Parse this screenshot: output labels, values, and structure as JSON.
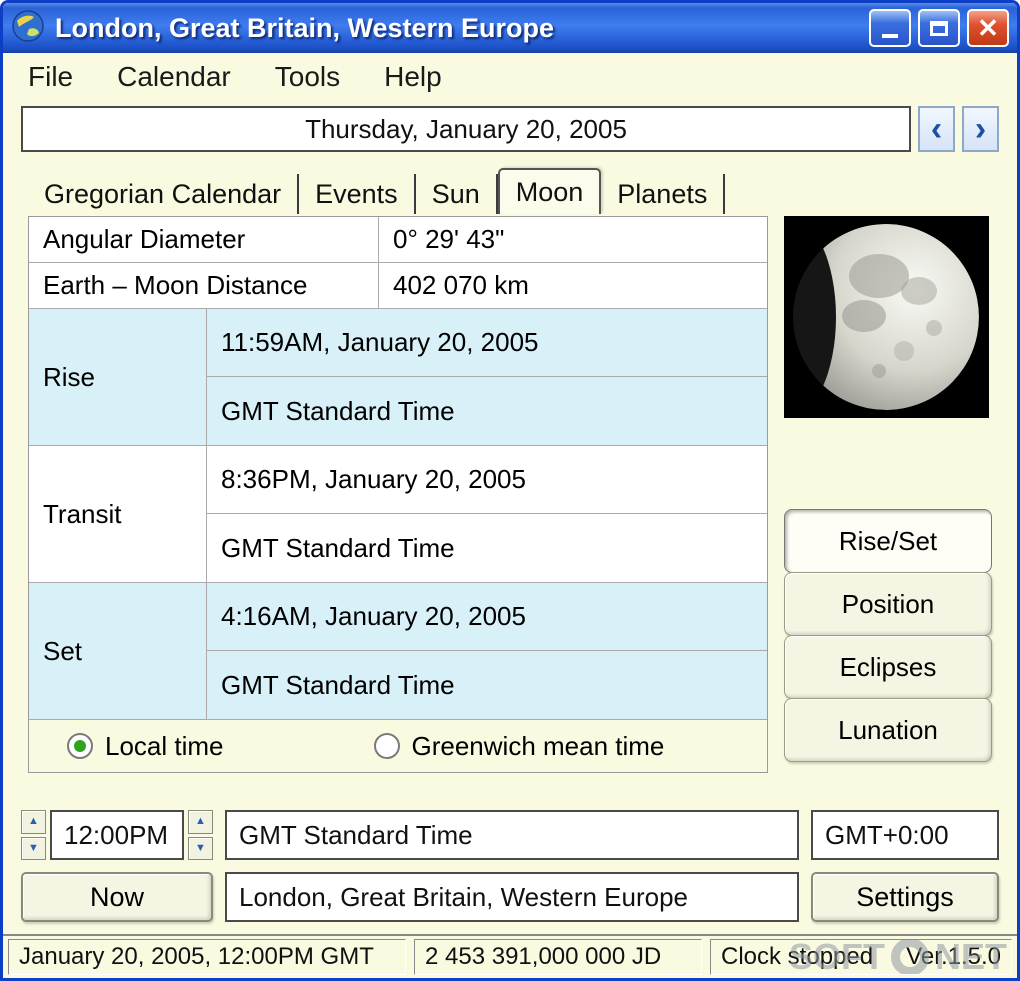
{
  "window": {
    "title": "London, Great Britain, Western Europe"
  },
  "icons": {
    "close": "✕",
    "spin_up": "▲",
    "spin_down": "▼"
  },
  "colors": {
    "titlebar_blue": "#2A62D8",
    "row_highlight_cyan": "#D8F0F8",
    "background_cream": "#FAFAE1",
    "radio_selected_green": "#2EA41C",
    "close_button_red": "#E0512E"
  },
  "menu": {
    "items": [
      "File",
      "Calendar",
      "Tools",
      "Help"
    ]
  },
  "date_nav": {
    "value": "Thursday, January 20, 2005",
    "prev": "‹",
    "next": "›"
  },
  "tabs": {
    "items": [
      "Gregorian Calendar",
      "Events",
      "Sun",
      "Moon",
      "Planets"
    ],
    "active": "Moon"
  },
  "moon_panel": {
    "info_rows": [
      {
        "label": "Angular Diameter",
        "value": "0° 29' 43\""
      },
      {
        "label": "Earth – Moon Distance",
        "value": "402 070 km"
      }
    ],
    "event_rows": [
      {
        "label": "Rise",
        "time": "11:59AM, January 20, 2005",
        "zone": "GMT Standard Time"
      },
      {
        "label": "Transit",
        "time": "8:36PM, January 20, 2005",
        "zone": "GMT Standard Time"
      },
      {
        "label": "Set",
        "time": "4:16AM, January 20, 2005",
        "zone": "GMT Standard Time"
      }
    ],
    "radios": [
      {
        "label": "Local time",
        "selected": true
      },
      {
        "label": "Greenwich mean time",
        "selected": false
      }
    ],
    "side_buttons": [
      "Rise/Set",
      "Position",
      "Eclipses",
      "Lunation"
    ],
    "active_view": "Rise/Set"
  },
  "bottom": {
    "time": "12:00PM",
    "timezone": "GMT Standard Time",
    "gmt_offset": "GMT+0:00",
    "now": "Now",
    "location": "London, Great Britain, Western Europe",
    "settings": "Settings"
  },
  "status": {
    "date_time": "January 20, 2005, 12:00PM GMT",
    "julian_date": "2 453 391,000 000 JD",
    "clock": "Clock stopped",
    "version": "Ver.1.5.0",
    "watermark_left": "SOFT",
    "watermark_right": "NET"
  }
}
